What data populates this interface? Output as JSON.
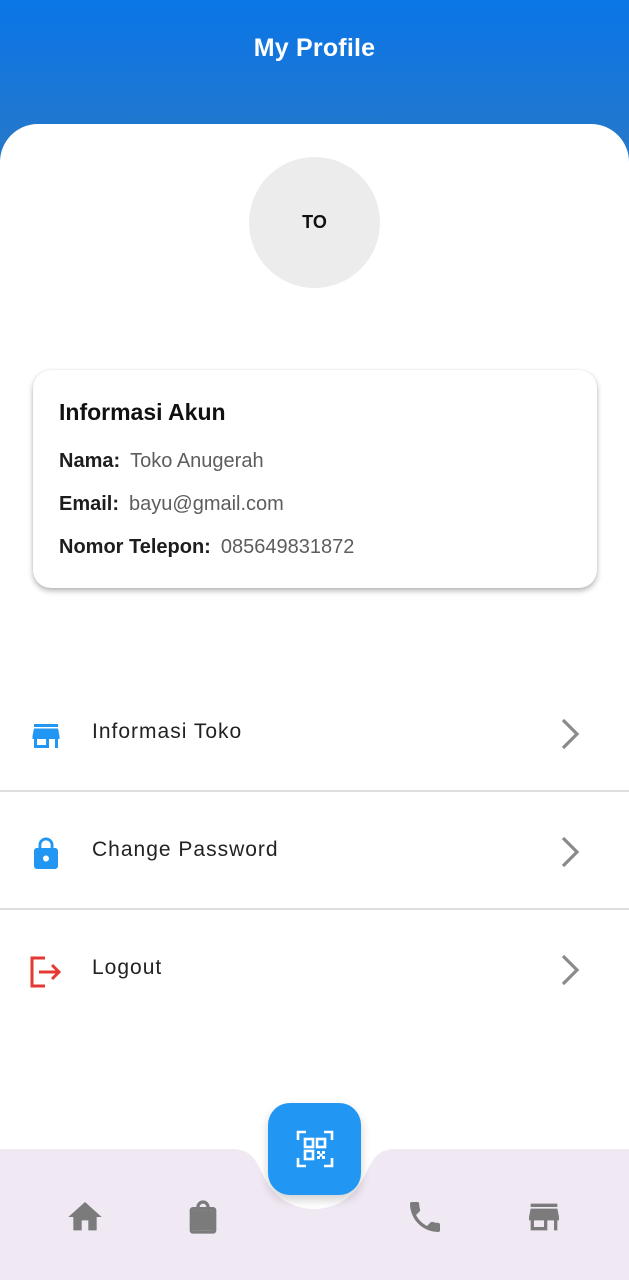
{
  "header": {
    "title": "My Profile",
    "color_top": "#0a76e8",
    "color_bottom": "#2a78c4"
  },
  "profile": {
    "avatar_initials": "TO"
  },
  "account_info": {
    "title": "Informasi Akun",
    "name_label": "Nama:",
    "name_value": "Toko Anugerah",
    "email_label": "Email:",
    "email_value": "bayu@gmail.com",
    "phone_label": "Nomor Telepon:",
    "phone_value": "085649831872"
  },
  "menu": {
    "items": [
      {
        "label": "Informasi Toko",
        "icon": "store-icon",
        "icon_color": "#2196f3"
      },
      {
        "label": "Change Password",
        "icon": "lock-icon",
        "icon_color": "#2196f3"
      },
      {
        "label": "Logout",
        "icon": "logout-icon",
        "icon_color": "#e53935"
      }
    ]
  },
  "bottom_nav": {
    "items": [
      {
        "icon": "home-icon"
      },
      {
        "icon": "shopping-bag-icon"
      },
      {
        "icon": "phone-icon"
      },
      {
        "icon": "store-icon"
      }
    ],
    "fab_icon": "qr-scan-icon",
    "background": "#f0e8f3",
    "fab_color": "#2196f3"
  }
}
